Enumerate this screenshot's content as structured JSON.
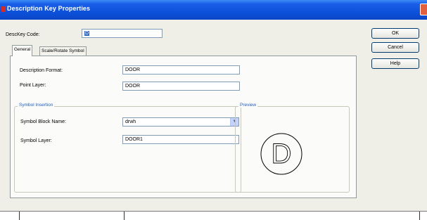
{
  "window": {
    "title": "Description Key Properties"
  },
  "desc_key_code": {
    "label": "DescKey Code:",
    "value": "D"
  },
  "buttons": {
    "ok": "OK",
    "cancel": "Cancel",
    "help": "Help"
  },
  "tabs": [
    {
      "label": "General",
      "active": true
    },
    {
      "label": "Scale/Rotate Symbol",
      "active": false
    }
  ],
  "general": {
    "description_format": {
      "label": "Description Format:",
      "value": "DOOR"
    },
    "point_layer": {
      "label": "Point Layer:",
      "value": "DOOR"
    }
  },
  "symbol_insertion": {
    "title": "Symbol Insertion",
    "symbol_block_name": {
      "label": "Symbol Block Name:",
      "value": "drwh"
    },
    "symbol_layer": {
      "label": "Symbol Layer:",
      "value": "DOOR1"
    }
  },
  "preview": {
    "title": "Preview",
    "glyph": "D"
  },
  "icons": {
    "app": "app-icon",
    "close": "close-icon",
    "dropdown": "chevron-down-icon"
  },
  "colors": {
    "titlebar": "#0b4fd8",
    "group_title": "#1c5fc6",
    "close_button": "#e0603d"
  }
}
